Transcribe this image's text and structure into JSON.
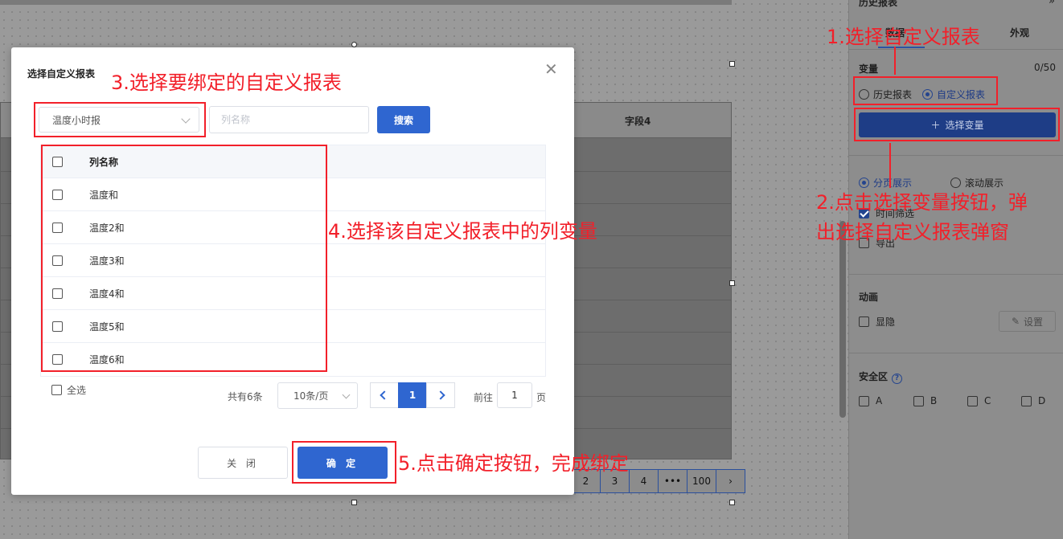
{
  "background": {
    "table_column_title": "字段4",
    "pager": [
      "2",
      "3",
      "4",
      "•••",
      "100",
      "›"
    ]
  },
  "panel": {
    "header_title": "历史报表",
    "collapse_icon": "»",
    "tabs": [
      "数据",
      "外观"
    ],
    "variable_label": "变量",
    "variable_count": "0/50",
    "source_options": [
      {
        "label": "历史报表",
        "selected": false
      },
      {
        "label": "自定义报表",
        "selected": true
      }
    ],
    "select_variable_button": "选择变量",
    "display_options": [
      {
        "label": "分页展示",
        "selected": true
      },
      {
        "label": "滚动展示",
        "selected": false
      }
    ],
    "time_filter_label": "时间筛选",
    "export_label": "导出",
    "animation_label": "动画",
    "visibility_label": "显隐",
    "settings_button": "设置",
    "safe_zone_label": "安全区",
    "safe_zone_options": [
      "A",
      "B",
      "C",
      "D"
    ]
  },
  "modal": {
    "title": "选择自定义报表",
    "report_select_value": "温度小时报",
    "column_search_placeholder": "列名称",
    "search_button": "搜索",
    "table_header": "列名称",
    "rows": [
      "温度和",
      "温度2和",
      "温度3和",
      "温度4和",
      "温度5和",
      "温度6和"
    ],
    "select_all_label": "全选",
    "total_text": "共有6条",
    "page_size": "10条/页",
    "current_page": "1",
    "goto_label": "前往",
    "goto_value": "1",
    "goto_suffix": "页",
    "close_button": "关 闭",
    "confirm_button": "确 定"
  },
  "annotations": {
    "step1": "1.选择自定义报表",
    "step2_line1": "2.点击选择变量按钮，弹",
    "step2_line2": "出选择自定义报表弹窗",
    "step3": "3.选择要绑定的自定义报表",
    "step4": "4.选择该自定义报表中的列变量",
    "step5": "5.点击确定按钮，完成绑定"
  }
}
